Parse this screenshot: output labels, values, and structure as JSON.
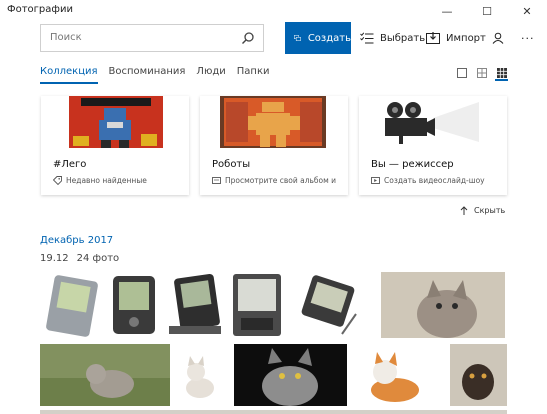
{
  "app": {
    "title": "Фотографии"
  },
  "window_controls": {
    "minimize": "—",
    "maximize": "☐",
    "close": "✕"
  },
  "search": {
    "placeholder": "Поиск"
  },
  "toolbar": {
    "create_label": "Создать",
    "select_label": "Выбрать",
    "import_label": "Импорт",
    "more_label": "···"
  },
  "nav": {
    "tabs": [
      "Коллекция",
      "Воспоминания",
      "Люди",
      "Папки"
    ],
    "active_tab": "Коллекция"
  },
  "cards": [
    {
      "title": "#Лего",
      "subtitle": "Недавно найденные",
      "icon": "tag-icon"
    },
    {
      "title": "Роботы",
      "subtitle": "Просмотрите свой альбом и",
      "icon": "album-icon"
    },
    {
      "title": "Вы — режиссер",
      "subtitle": "Создать видеослайд-шоу",
      "icon": "video-icon"
    }
  ],
  "hide_label": "Скрыть",
  "month_header": "Декабрь 2017",
  "day_group": {
    "date": "19.12",
    "count": "24 фото"
  },
  "colors": {
    "accent": "#0063b1",
    "card_red": "#c8321e"
  }
}
